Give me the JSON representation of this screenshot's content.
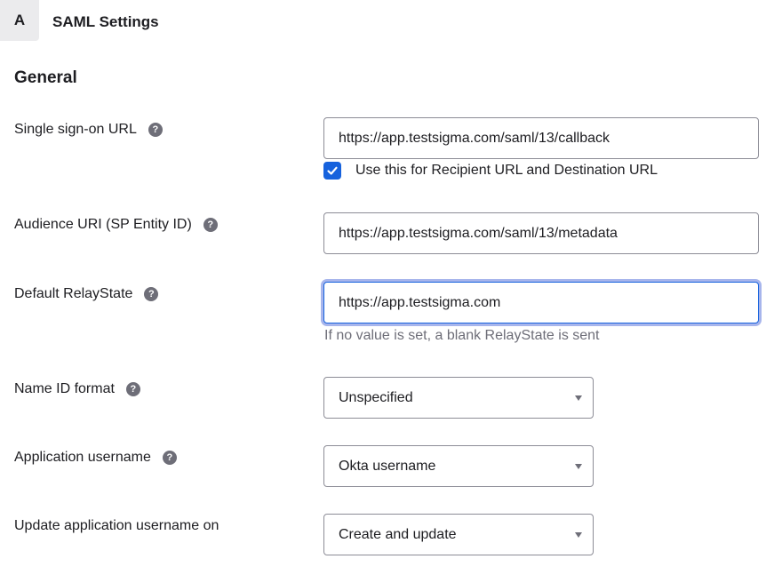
{
  "step": {
    "badge": "A",
    "title": "SAML Settings"
  },
  "section": {
    "title": "General"
  },
  "fields": {
    "sso_url": {
      "label": "Single sign-on URL",
      "value": "https://app.testsigma.com/saml/13/callback",
      "checkbox_label": "Use this for Recipient URL and Destination URL",
      "checkbox_checked": true
    },
    "audience_uri": {
      "label": "Audience URI (SP Entity ID)",
      "value": "https://app.testsigma.com/saml/13/metadata"
    },
    "relay_state": {
      "label": "Default RelayState",
      "value": "https://app.testsigma.com",
      "hint": "If no value is set, a blank RelayState is sent"
    },
    "name_id_format": {
      "label": "Name ID format",
      "selected": "Unspecified"
    },
    "app_username": {
      "label": "Application username",
      "selected": "Okta username"
    },
    "update_username_on": {
      "label": "Update application username on",
      "selected": "Create and update"
    }
  },
  "help_icon_glyph": "?",
  "colors": {
    "accent": "#1662dd",
    "focus_ring": "#a7b5ec",
    "muted_text": "#6e6e78",
    "border": "#8c8c96"
  }
}
